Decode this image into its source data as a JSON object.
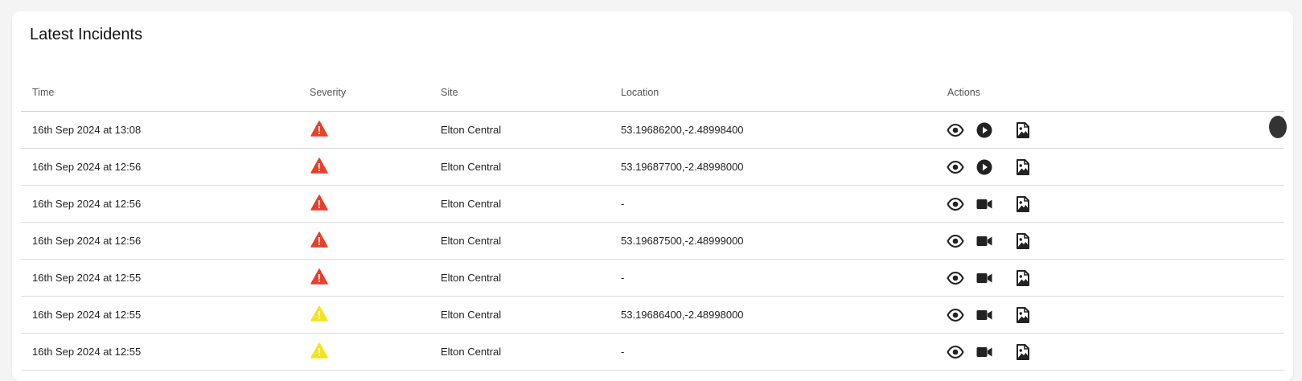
{
  "panel": {
    "title": "Latest Incidents"
  },
  "table": {
    "columns": {
      "time": "Time",
      "severity": "Severity",
      "site": "Site",
      "location": "Location",
      "actions": "Actions"
    },
    "rows": [
      {
        "time": "16th Sep 2024 at 13:08",
        "severity": "high",
        "site": "Elton Central",
        "location": "53.19686200,-2.48998400",
        "media": "play"
      },
      {
        "time": "16th Sep 2024 at 12:56",
        "severity": "high",
        "site": "Elton Central",
        "location": "53.19687700,-2.48998000",
        "media": "play"
      },
      {
        "time": "16th Sep 2024 at 12:56",
        "severity": "high",
        "site": "Elton Central",
        "location": "-",
        "media": "video"
      },
      {
        "time": "16th Sep 2024 at 12:56",
        "severity": "high",
        "site": "Elton Central",
        "location": "53.19687500,-2.48999000",
        "media": "video"
      },
      {
        "time": "16th Sep 2024 at 12:55",
        "severity": "high",
        "site": "Elton Central",
        "location": "-",
        "media": "video"
      },
      {
        "time": "16th Sep 2024 at 12:55",
        "severity": "medium",
        "site": "Elton Central",
        "location": "53.19686400,-2.48998000",
        "media": "video"
      },
      {
        "time": "16th Sep 2024 at 12:55",
        "severity": "medium",
        "site": "Elton Central",
        "location": "-",
        "media": "video"
      }
    ]
  },
  "colors": {
    "severity_high": "#e5412d",
    "severity_medium": "#f5e31c",
    "icon": "#222222"
  },
  "icons": {
    "view": "eye-icon",
    "play": "play-circle-icon",
    "video": "video-camera-icon",
    "report": "image-file-icon",
    "severity": "warning-triangle-icon"
  }
}
